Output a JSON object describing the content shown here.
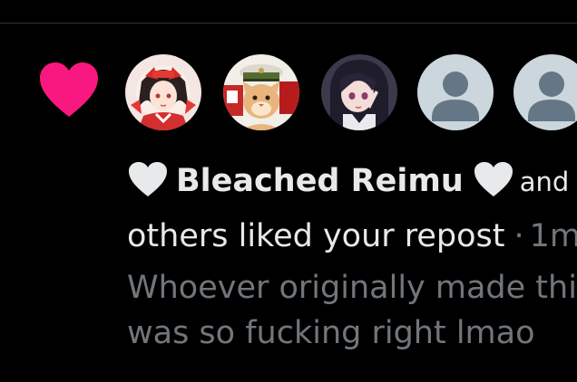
{
  "notification": {
    "type_icon": "heart-icon",
    "accent_color": "#f91880",
    "avatars": [
      {
        "name": "avatar-1",
        "kind": "anime-shrine-maiden"
      },
      {
        "name": "avatar-2",
        "kind": "cat-with-cap"
      },
      {
        "name": "avatar-3",
        "kind": "anime-girl-dark-hair"
      },
      {
        "name": "avatar-4",
        "kind": "default-profile"
      },
      {
        "name": "avatar-5",
        "kind": "default-profile"
      }
    ],
    "line1": {
      "user_name": "Bleached Reimu",
      "and_text": "and"
    },
    "line2": {
      "action_text": "others liked your repost",
      "separator": "·",
      "timestamp": "1m"
    },
    "post_preview": {
      "line1": "Whoever originally made thi",
      "line2": "was so fucking right lmao"
    }
  }
}
